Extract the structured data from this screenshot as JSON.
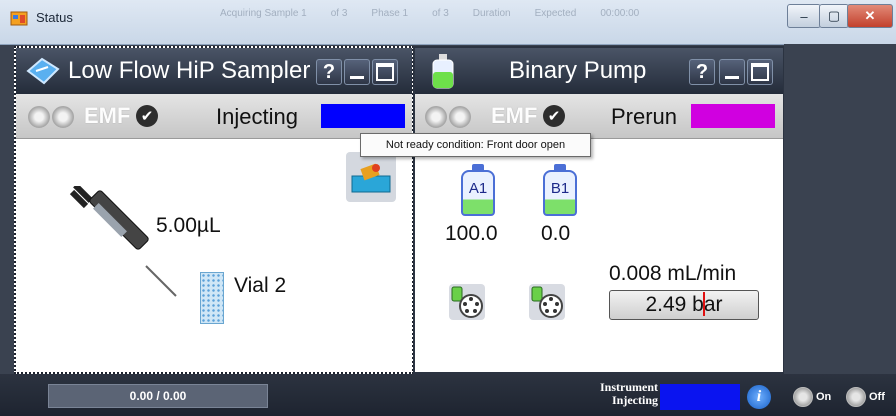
{
  "window": {
    "title": "Status",
    "faded_info": [
      "Acquiring Sample 1",
      "of 3",
      "Phase 1",
      "of 3",
      "Duration",
      "Expected",
      "00:00:00"
    ],
    "buttons": {
      "minimize": "–",
      "maximize": "▢",
      "close": "✕"
    }
  },
  "sampler": {
    "title": "Low Flow HiP Sampler",
    "help": "?",
    "emf": "EMF",
    "state": "Injecting",
    "state_color": "#0000ff",
    "volume": "5.00µL",
    "vial": "Vial 2"
  },
  "pump": {
    "title": "Binary Pump",
    "help": "?",
    "emf": "EMF",
    "state": "Prerun",
    "state_color": "#d000e0",
    "solvent_a_label": "A1",
    "solvent_b_label": "B1",
    "solvent_a_value": "100.0",
    "solvent_b_value": "0.0",
    "flow": "0.008 mL/min",
    "pressure": "2.49 bar"
  },
  "tooltip": "Not ready condition: Front door open",
  "bottom": {
    "progress": "0.00 / 0.00",
    "instrument_label_1": "Instrument",
    "instrument_label_2": "Injecting",
    "instrument_color": "#0000ff",
    "info": "i",
    "on_label": "On",
    "off_label": "Off"
  }
}
